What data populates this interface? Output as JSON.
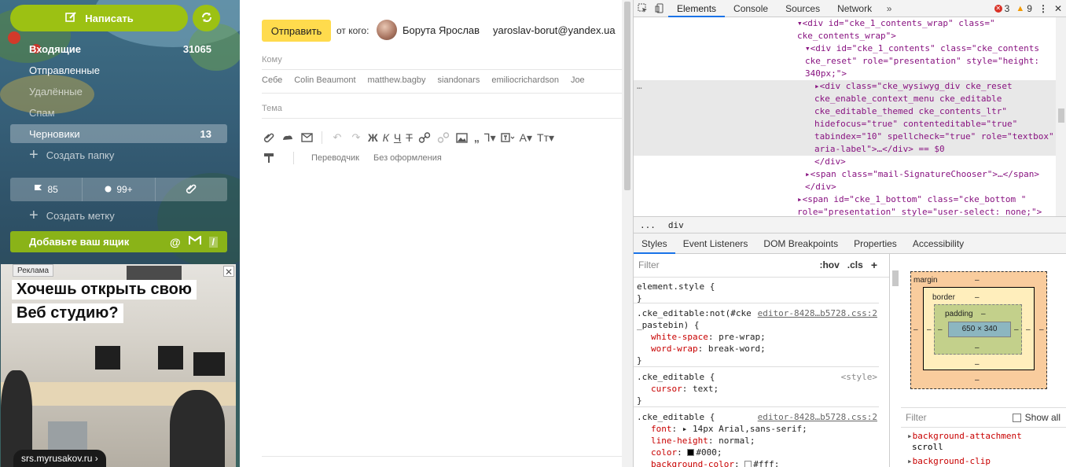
{
  "sidebar": {
    "compose_label": "Написать",
    "folders": [
      {
        "label": "Входящие",
        "count": "31065"
      },
      {
        "label": "Отправленные",
        "count": ""
      },
      {
        "label": "Удалённые",
        "count": ""
      },
      {
        "label": "Спам",
        "count": ""
      },
      {
        "label": "Черновики",
        "count": "13"
      }
    ],
    "create_folder": "Создать папку",
    "filters": [
      {
        "icon": "flag-icon",
        "label": "85"
      },
      {
        "icon": "dot-icon",
        "label": "99+"
      },
      {
        "icon": "paperclip-icon",
        "label": ""
      }
    ],
    "create_label": "Создать метку",
    "add_box": "Добавьте ваш ящик",
    "ad": {
      "tag": "Реклама",
      "line1": "Хочешь открыть свою",
      "line2": "Веб студию?",
      "url": "srs.myrusakov.ru ›"
    }
  },
  "compose": {
    "send_label": "Отправить",
    "from_label": "от кого:",
    "from_name": "Борута Ярослав",
    "from_email": "yaroslav-borut@yandex.ua",
    "to_label": "Кому",
    "contacts": [
      "Себе",
      "Colin Beaumont",
      "matthew.bagby",
      "siandonars",
      "emiliocrichardson",
      "Joe"
    ],
    "subject_label": "Тема",
    "translator": "Переводчик",
    "no_format": "Без оформления"
  },
  "devtools": {
    "tabs": [
      "Elements",
      "Console",
      "Sources",
      "Network"
    ],
    "errors": "3",
    "warnings": "9",
    "dom_lines": [
      {
        "indent": 0,
        "html": "▾<div id=\"cke_1_contents_wrap\" class=\""
      },
      {
        "indent": 0,
        "html": "cke_contents_wrap\">"
      },
      {
        "indent": 1,
        "html": "▾<div id=\"cke_1_contents\" class=\"cke_contents"
      },
      {
        "indent": 1,
        "html": "cke_reset\" role=\"presentation\" style=\"height:"
      },
      {
        "indent": 1,
        "html": "340px;\">"
      },
      {
        "indent": 2,
        "html": "▸<div class=\"cke_wysiwyg_div cke_reset"
      },
      {
        "indent": 2,
        "html": "cke_enable_context_menu cke_editable"
      },
      {
        "indent": 2,
        "html": "cke_editable_themed cke_contents_ltr\""
      },
      {
        "indent": 2,
        "html": "hidefocus=\"true\" contenteditable=\"true\""
      },
      {
        "indent": 2,
        "html": "tabindex=\"10\" spellcheck=\"true\" role=\"textbox\""
      },
      {
        "indent": 2,
        "html": " aria-label\">…</div> == $0"
      },
      {
        "indent": 2,
        "html": "</div>"
      },
      {
        "indent": 1,
        "html": "▸<span class=\"mail-SignatureChooser\">…</span>"
      },
      {
        "indent": 1,
        "html": "</div>"
      },
      {
        "indent": 0,
        "html": "▸<span id=\"cke_1_bottom\" class=\"cke_bottom \""
      },
      {
        "indent": 0,
        "html": "role=\"presentation\" style=\"user-select: none;\">"
      }
    ],
    "breadcrumb": [
      "...",
      "div"
    ],
    "sub_tabs": [
      "Styles",
      "Event Listeners",
      "DOM Breakpoints",
      "Properties",
      "Accessibility"
    ],
    "filter_placeholder": "Filter",
    "hov": ":hov",
    "cls": ".cls",
    "rules": [
      {
        "selector": "element.style {",
        "source": "",
        "props": [],
        "close": "}"
      },
      {
        "selector": ".cke_editable:not(#cke",
        "selector2": "_pastebin) {",
        "source": "editor-8428…b5728.css:2",
        "props": [
          [
            "white-space",
            "pre-wrap;"
          ],
          [
            "word-wrap",
            "break-word;"
          ]
        ],
        "close": "}"
      },
      {
        "selector": ".cke_editable {",
        "source": "<style>",
        "props": [
          [
            "cursor",
            "text;"
          ]
        ],
        "close": "}"
      },
      {
        "selector": ".cke_editable {",
        "source": "editor-8428…b5728.css:2",
        "props": [
          [
            "font",
            "▸ 14px Arial,sans-serif;"
          ],
          [
            "line-height",
            "normal;"
          ],
          [
            "color",
            "#000;"
          ],
          [
            "background-color",
            "#fff;"
          ]
        ],
        "close": ""
      }
    ],
    "box_model": {
      "margin_label": "margin",
      "border_label": "border",
      "padding_label": "padding",
      "dash": "–",
      "content": "650 × 340"
    },
    "computed_filter": "Filter",
    "show_all": "Show all",
    "computed": [
      {
        "name": "background-attachment",
        "value": "scroll"
      },
      {
        "name": "background-clip",
        "value": ""
      }
    ]
  }
}
